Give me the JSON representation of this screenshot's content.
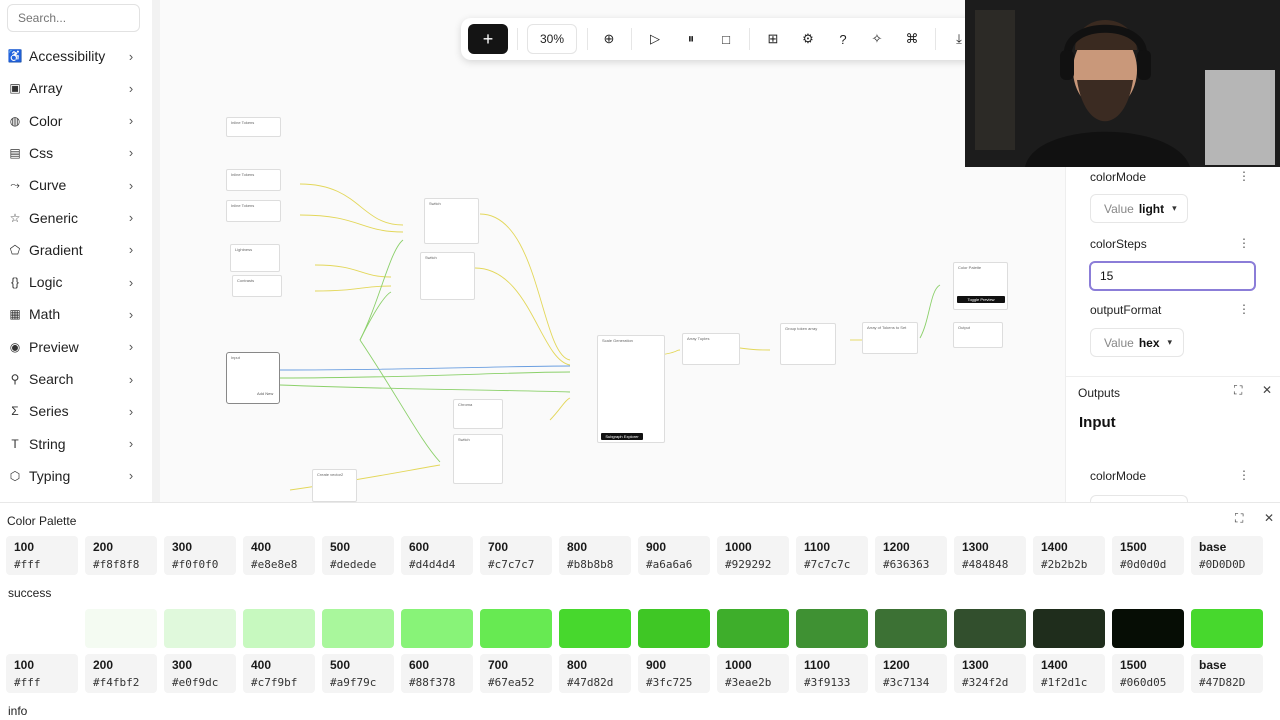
{
  "sidebar": {
    "search_placeholder": "Search...",
    "items": [
      {
        "label": "Accessibility",
        "icon": "accessibility-icon",
        "glyph": "♿"
      },
      {
        "label": "Array",
        "icon": "array-icon",
        "glyph": "▣"
      },
      {
        "label": "Color",
        "icon": "color-icon",
        "glyph": "◍"
      },
      {
        "label": "Css",
        "icon": "css-icon",
        "glyph": "▤"
      },
      {
        "label": "Curve",
        "icon": "curve-icon",
        "glyph": "⤳"
      },
      {
        "label": "Generic",
        "icon": "star-icon",
        "glyph": "☆"
      },
      {
        "label": "Gradient",
        "icon": "gradient-icon",
        "glyph": "⬠"
      },
      {
        "label": "Logic",
        "icon": "braces-icon",
        "glyph": "{}"
      },
      {
        "label": "Math",
        "icon": "calculator-icon",
        "glyph": "▦"
      },
      {
        "label": "Preview",
        "icon": "eye-icon",
        "glyph": "◉"
      },
      {
        "label": "Search",
        "icon": "search-icon",
        "glyph": "⚲"
      },
      {
        "label": "Series",
        "icon": "sigma-icon",
        "glyph": "Σ"
      },
      {
        "label": "String",
        "icon": "text-icon",
        "glyph": "T"
      },
      {
        "label": "Typing",
        "icon": "typing-icon",
        "glyph": "⬡"
      }
    ]
  },
  "toolbar": {
    "zoom": "30%",
    "buttons": [
      "add-node",
      "layout",
      "play",
      "pause",
      "stop",
      "table",
      "settings",
      "help",
      "magic",
      "shortcut",
      "download",
      "upload",
      "save",
      "share"
    ]
  },
  "right_panel": {
    "color_mode_label": "colorMode",
    "value_prefix": "Value",
    "color_mode_value": "light",
    "color_steps_label": "colorSteps",
    "color_steps_value": "15",
    "output_format_label": "outputFormat",
    "output_format_value": "hex",
    "outputs_title": "Outputs",
    "outputs_node": "Input",
    "outputs_color_mode_label": "colorMode"
  },
  "palette": {
    "title": "Color Palette",
    "neutral": [
      {
        "step": "100",
        "hex": "#fff"
      },
      {
        "step": "200",
        "hex": "#f8f8f8"
      },
      {
        "step": "300",
        "hex": "#f0f0f0"
      },
      {
        "step": "400",
        "hex": "#e8e8e8"
      },
      {
        "step": "500",
        "hex": "#dedede"
      },
      {
        "step": "600",
        "hex": "#d4d4d4"
      },
      {
        "step": "700",
        "hex": "#c7c7c7"
      },
      {
        "step": "800",
        "hex": "#b8b8b8"
      },
      {
        "step": "900",
        "hex": "#a6a6a6"
      },
      {
        "step": "1000",
        "hex": "#929292"
      },
      {
        "step": "1100",
        "hex": "#7c7c7c"
      },
      {
        "step": "1200",
        "hex": "#636363"
      },
      {
        "step": "1300",
        "hex": "#484848"
      },
      {
        "step": "1400",
        "hex": "#2b2b2b"
      },
      {
        "step": "1500",
        "hex": "#0d0d0d"
      },
      {
        "step": "base",
        "hex": "#0D0D0D"
      }
    ],
    "success_label": "success",
    "success": [
      {
        "step": "100",
        "hex": "#fff"
      },
      {
        "step": "200",
        "hex": "#f4fbf2"
      },
      {
        "step": "300",
        "hex": "#e0f9dc"
      },
      {
        "step": "400",
        "hex": "#c7f9bf"
      },
      {
        "step": "500",
        "hex": "#a9f79c"
      },
      {
        "step": "600",
        "hex": "#88f378"
      },
      {
        "step": "700",
        "hex": "#67ea52"
      },
      {
        "step": "800",
        "hex": "#47d82d"
      },
      {
        "step": "900",
        "hex": "#3fc725"
      },
      {
        "step": "1000",
        "hex": "#3eae2b"
      },
      {
        "step": "1100",
        "hex": "#3f9133"
      },
      {
        "step": "1200",
        "hex": "#3c7134"
      },
      {
        "step": "1300",
        "hex": "#324f2d"
      },
      {
        "step": "1400",
        "hex": "#1f2d1c"
      },
      {
        "step": "1500",
        "hex": "#060d05"
      },
      {
        "step": "base",
        "hex": "#47D82D"
      }
    ],
    "info_label": "info"
  },
  "graph": {
    "nodes": [
      {
        "title": "Inline Tokens"
      },
      {
        "title": "Inline Tokens"
      },
      {
        "title": "Inline Tokens"
      },
      {
        "title": "Lightness"
      },
      {
        "title": "Contrasts"
      },
      {
        "title": "Switch"
      },
      {
        "title": "Switch"
      },
      {
        "title": "Input"
      },
      {
        "title": "Chroma"
      },
      {
        "title": "Switch"
      },
      {
        "title": "Create vector2"
      },
      {
        "title": "Scale Generation"
      },
      {
        "title": "Array Tuples"
      },
      {
        "title": "Group token array"
      },
      {
        "title": "Array of Tokens to Set"
      },
      {
        "title": "Color Palette"
      },
      {
        "title": "Output"
      }
    ],
    "preview_button": "Toggle Preview",
    "subgraph_button": "Subgraph Explorer",
    "add_new": "Add New"
  },
  "colors": {
    "accent": "#8b7dd8",
    "dark": "#141414"
  }
}
